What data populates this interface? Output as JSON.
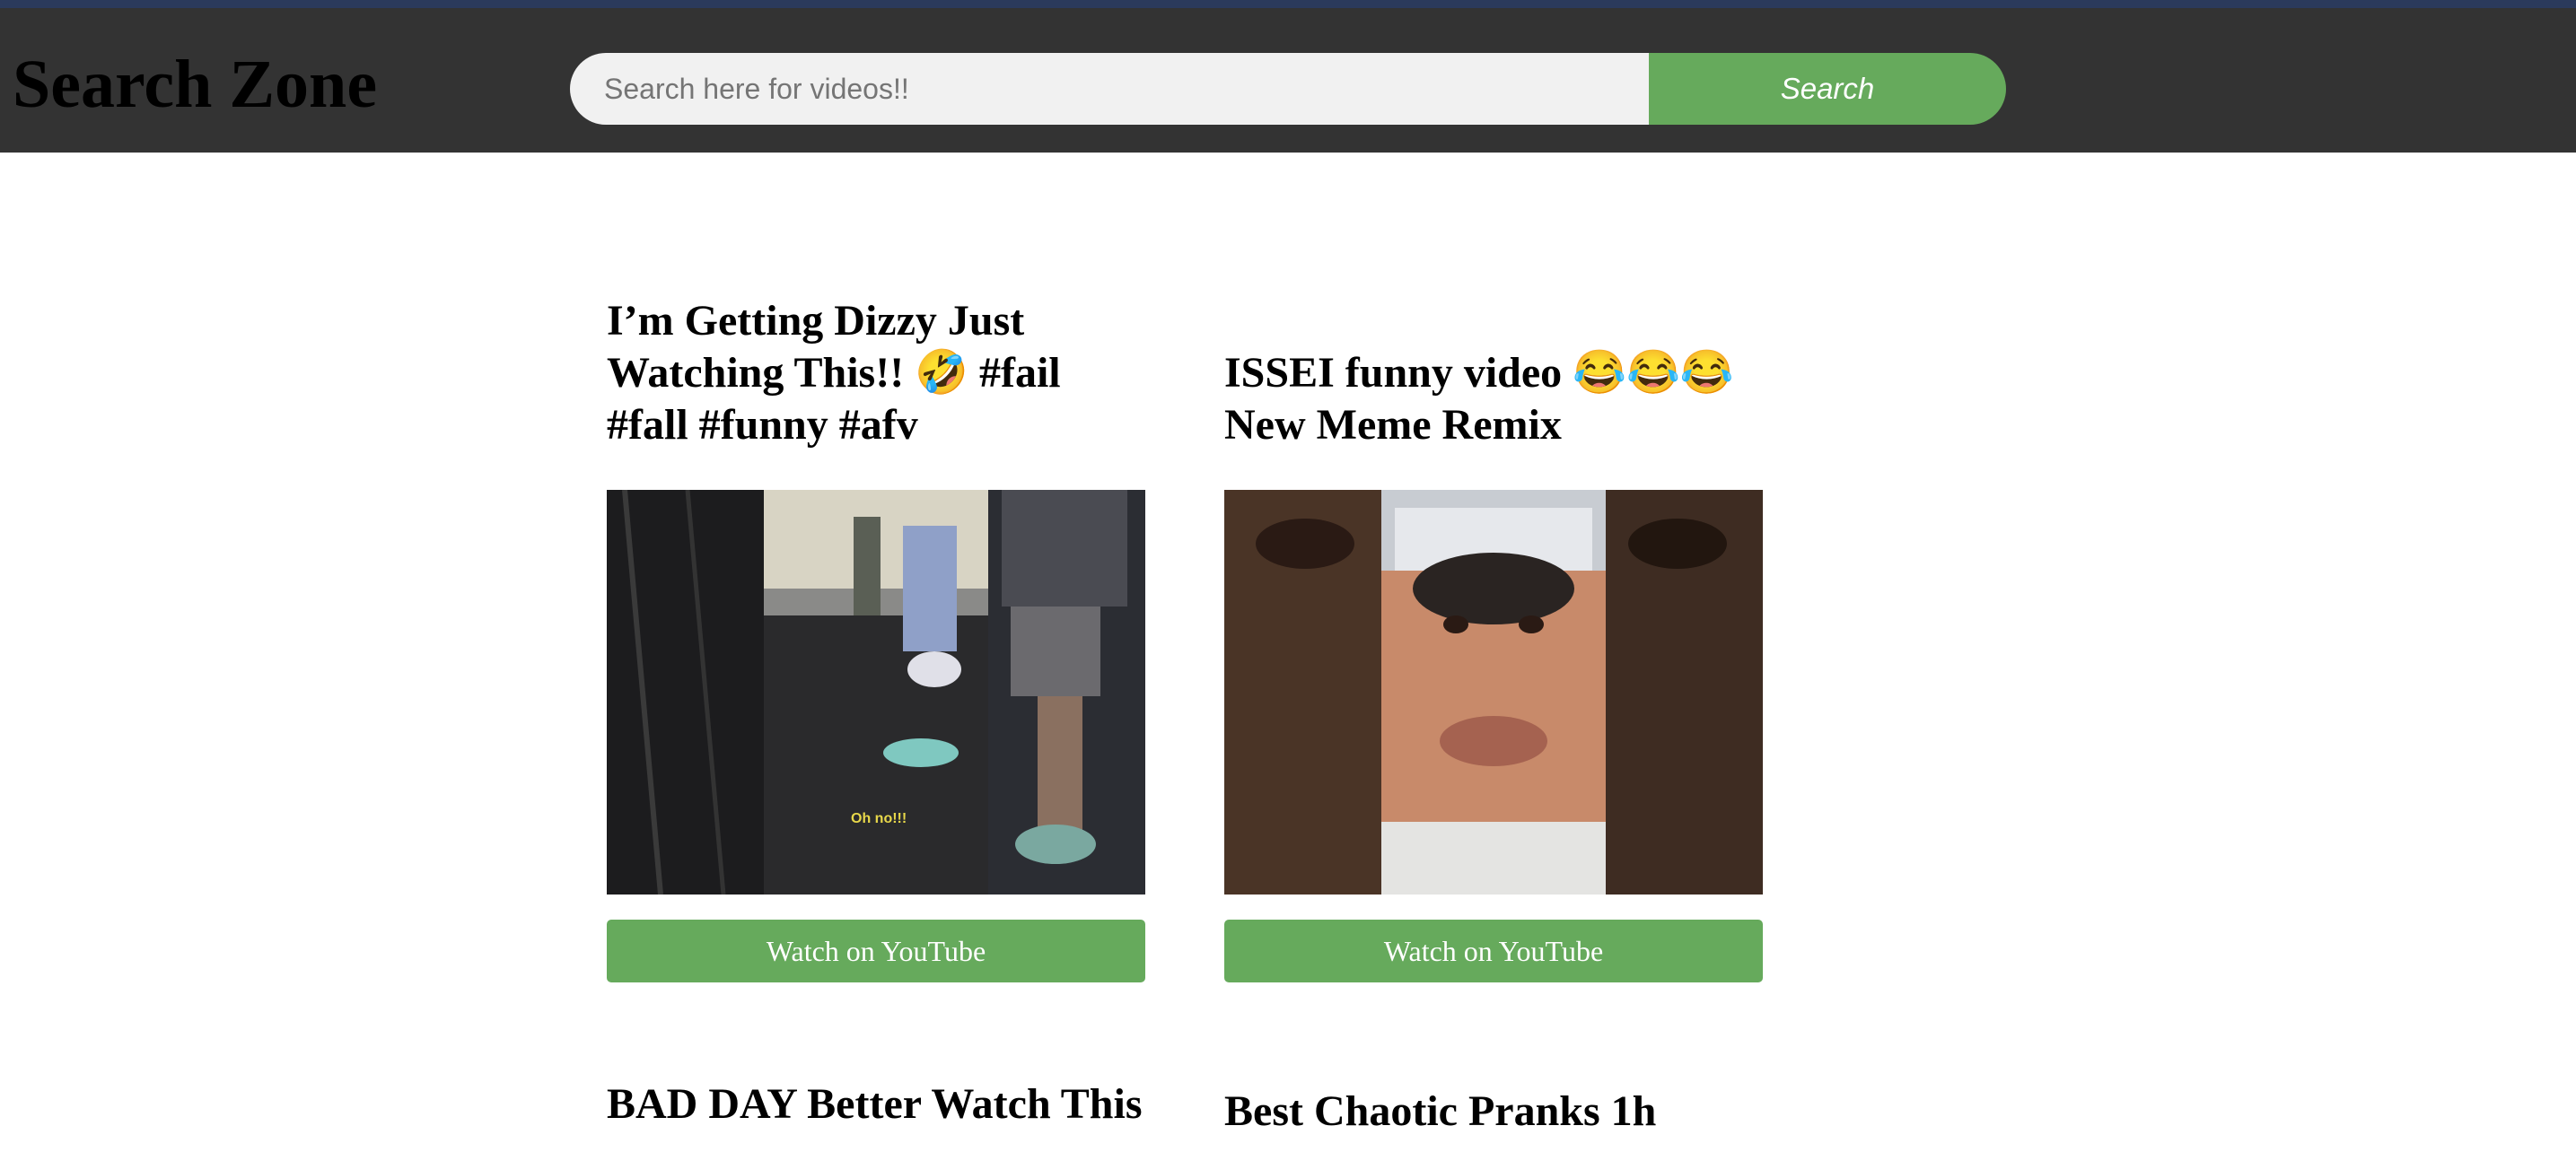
{
  "header": {
    "logo": "Search Zone",
    "search_placeholder": "Search here for videos!!",
    "search_button": "Search"
  },
  "colors": {
    "navbar": "#333333",
    "top_strip": "#2b3a5c",
    "accent_green": "#66aa5c",
    "input_bg": "#f1f1f1"
  },
  "results": [
    {
      "title": "I’m Getting Dizzy Just Watching This!! 🤣 #fail #fall #funny #afv",
      "thumbnail_caption": "Oh no!!!",
      "button": "Watch on YouTube"
    },
    {
      "title": "ISSEI funny video 😂😂😂 New Meme Remix",
      "button": "Watch on YouTube"
    },
    {
      "title": "BAD DAY Better Watch This"
    },
    {
      "title": "Best Chaotic Pranks 1h"
    }
  ]
}
